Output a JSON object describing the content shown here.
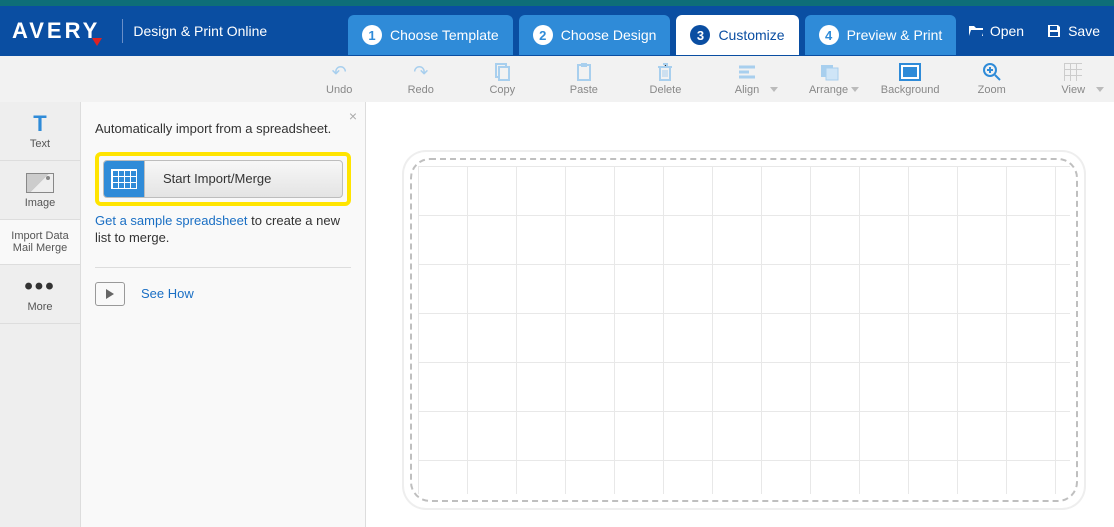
{
  "header": {
    "brand": "AVERY",
    "subtitle": "Design & Print Online",
    "actions": {
      "open": "Open",
      "save": "Save"
    }
  },
  "steps": [
    {
      "num": "1",
      "label": "Choose Template"
    },
    {
      "num": "2",
      "label": "Choose Design"
    },
    {
      "num": "3",
      "label": "Customize"
    },
    {
      "num": "4",
      "label": "Preview & Print"
    }
  ],
  "active_step_index": 2,
  "toolbar": {
    "undo": "Undo",
    "redo": "Redo",
    "copy": "Copy",
    "paste": "Paste",
    "delete": "Delete",
    "align": "Align",
    "arrange": "Arrange",
    "background": "Background",
    "zoom": "Zoom",
    "view": "View"
  },
  "left_tabs": {
    "text": "Text",
    "image": "Image",
    "merge": "Import Data Mail Merge",
    "more": "More"
  },
  "panel": {
    "intro": "Automatically import from a spreadsheet.",
    "start_btn": "Start Import/Merge",
    "sample_link": "Get a sample spreadsheet",
    "sample_rest": " to create a new list to merge.",
    "see_how": "See How"
  }
}
